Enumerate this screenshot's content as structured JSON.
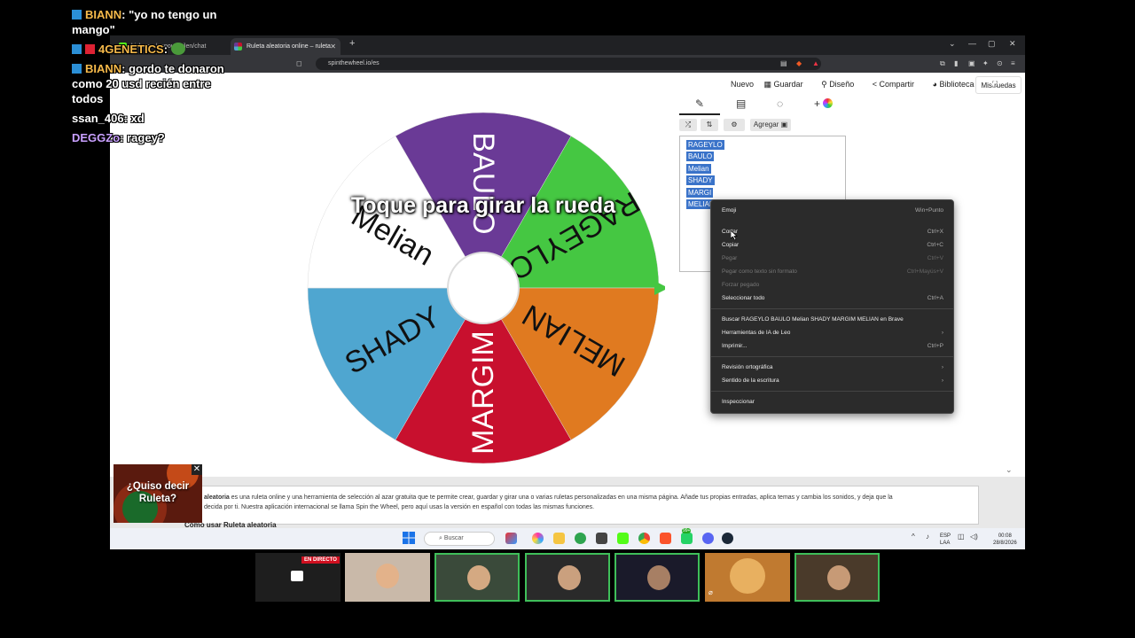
{
  "browser": {
    "tabs": [
      {
        "label": "kick.com/popout/...ilen/chat",
        "active": false
      },
      {
        "label": "Ruleta aleatoria online – ruleta",
        "active": true
      }
    ],
    "url": "spinthewheel.io/es"
  },
  "top_menu": {
    "nuevo": "Nuevo",
    "guardar": "Guardar",
    "diseno": "Diseño",
    "compartir": "Compartir",
    "biblioteca": "Biblioteca",
    "mis_ruedas": "Mis ruedas"
  },
  "toolbar": {
    "agregar": "Agregar"
  },
  "wheel": {
    "overlay": "Toque para girar la rueda",
    "segments": [
      {
        "label": "BAULO",
        "color": "#6a3a96"
      },
      {
        "label": "RAGEYLO",
        "color": "#45c742"
      },
      {
        "label": "MELIAN",
        "color": "#e07a20"
      },
      {
        "label": "MARGIM",
        "color": "#c8102e"
      },
      {
        "label": "SHADY",
        "color": "#4fa6d0"
      },
      {
        "label": "Melian",
        "color": "#ffffff"
      }
    ],
    "pointer_color": "#45c742"
  },
  "entries": [
    "RAGEYLO",
    "BAULO",
    "Melian",
    "SHADY",
    "MARGI",
    "MELIAN"
  ],
  "context_menu": {
    "items": [
      {
        "label": "Emoji",
        "shortcut": "Win+Punto",
        "disabled": false
      },
      {
        "label": "Cortar",
        "shortcut": "Ctrl+X",
        "disabled": false
      },
      {
        "label": "Copiar",
        "shortcut": "Ctrl+C",
        "disabled": false
      },
      {
        "label": "Pegar",
        "shortcut": "Ctrl+V",
        "disabled": true
      },
      {
        "label": "Pegar como texto sin formato",
        "shortcut": "Ctrl+Mayús+V",
        "disabled": true
      },
      {
        "label": "Forzar pegado",
        "shortcut": "",
        "disabled": true
      },
      {
        "label": "Seleccionar todo",
        "shortcut": "Ctrl+A",
        "disabled": false
      },
      {
        "label": "Buscar RAGEYLO BAULO Melian SHADY MARGIM MELIAN en Brave",
        "shortcut": "",
        "disabled": false
      },
      {
        "label": "Herramientas de IA de Leo",
        "shortcut": "",
        "disabled": false
      },
      {
        "label": "Imprimir...",
        "shortcut": "Ctrl+P",
        "disabled": false
      },
      {
        "label": "Revisión ortográfica",
        "shortcut": "",
        "disabled": false
      },
      {
        "label": "Sentido de la escritura",
        "shortcut": "",
        "disabled": false
      },
      {
        "label": "Inspeccionar",
        "shortcut": "",
        "disabled": false
      }
    ]
  },
  "info": {
    "bold": "aleatoria",
    "text": " es una ruleta online y una herramienta de selección al azar gratuita que te permite crear, guardar y girar una o varias ruletas personalizadas en una misma página. Añade tus propias entradas, aplica temas y cambia los sonidos, y deja que la",
    "text2": "decida por ti. Nuestra aplicación internacional se llama Spin the Wheel, pero aquí usas la versión en español con todas las mismas funciones.",
    "how_to": "Cómo usar Ruleta aleatoria"
  },
  "taskbar": {
    "search": "Buscar",
    "lang": "ESP",
    "lang2": "LAA",
    "time": "00:08",
    "date": "28/8/2026",
    "badge": "99+"
  },
  "chat": [
    {
      "user": "BIANN",
      "msg": ": \"yo no tengo un mango\""
    },
    {
      "user": "4GENETICS",
      "msg": ":"
    },
    {
      "user": "BIANN",
      "msg": ": gordo te donaron como 20 usd recién entre todos"
    },
    {
      "user": "ssan_406",
      "msg": ": xd"
    },
    {
      "user": "DEGGZo",
      "msg": ": ragey?"
    }
  ],
  "popup": {
    "text": "¿Quiso decir Ruleta?"
  },
  "stream": {
    "live": "EN DIRECTO"
  }
}
